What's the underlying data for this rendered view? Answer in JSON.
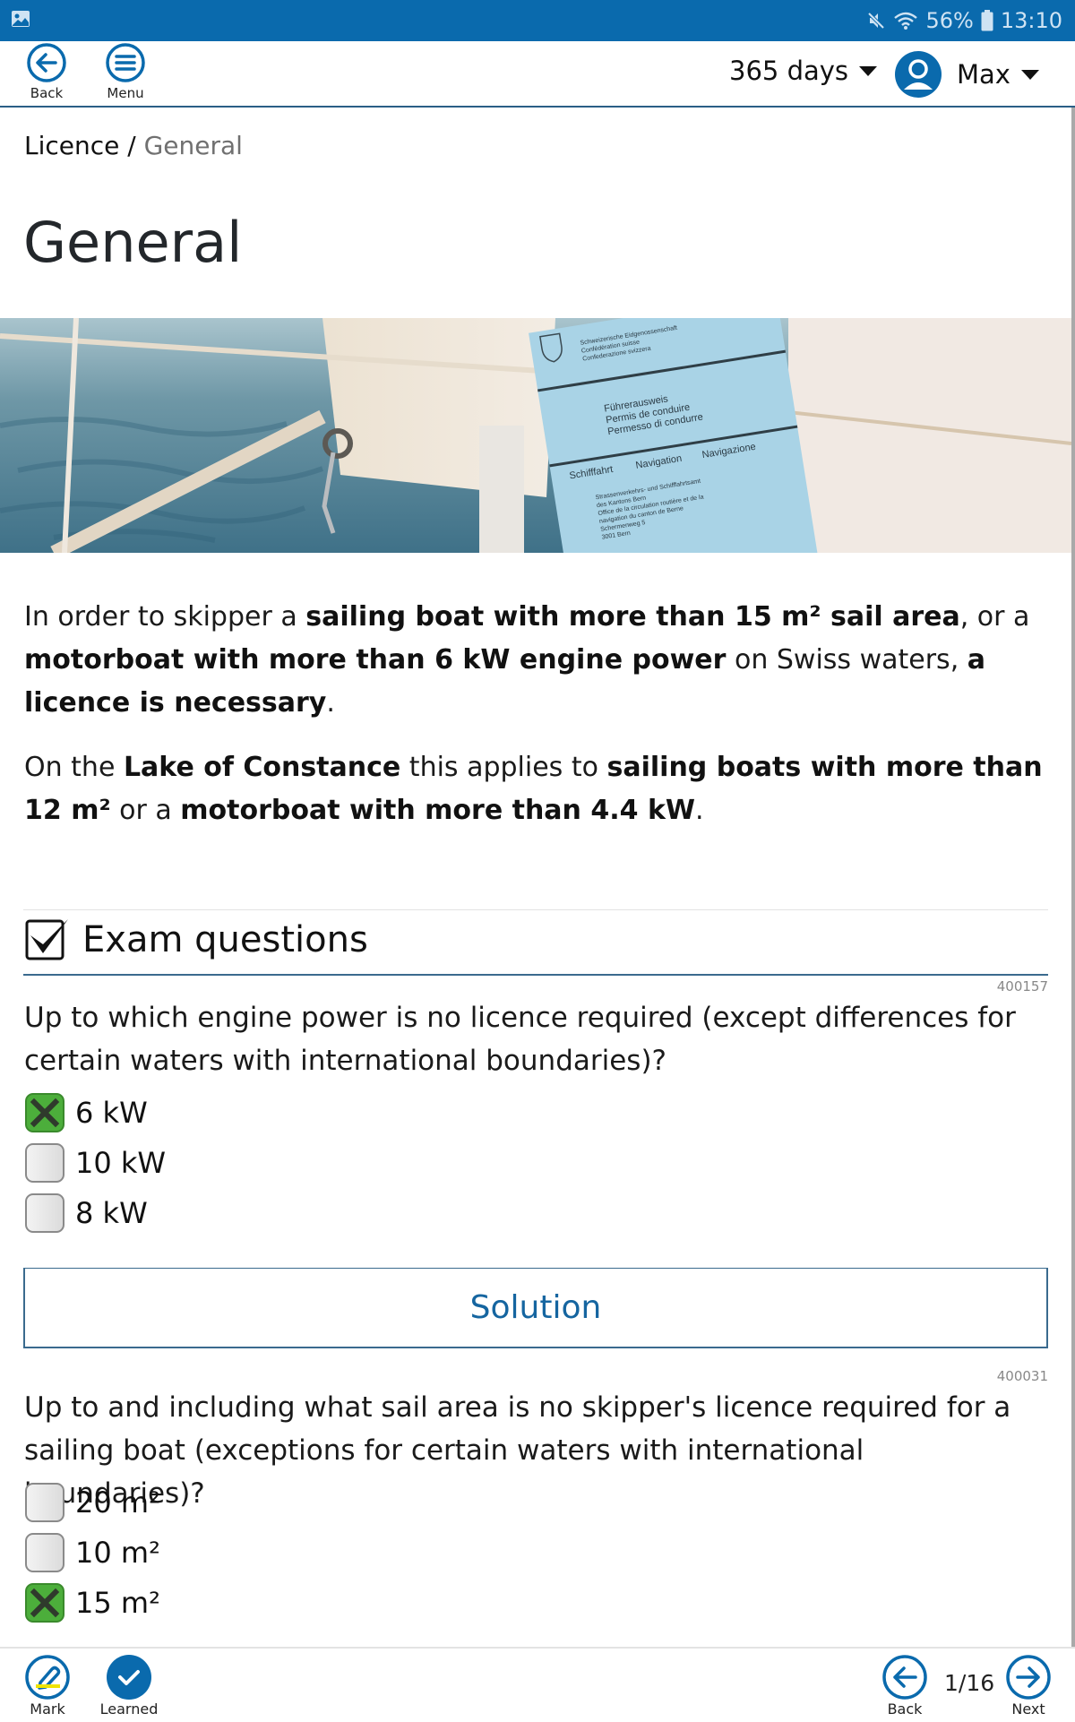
{
  "status_bar": {
    "battery": "56%",
    "time": "13:10",
    "icons": [
      "gallery-icon",
      "mute-icon",
      "wifi-icon",
      "battery-icon"
    ]
  },
  "header": {
    "back_label": "Back",
    "menu_label": "Menu",
    "period_select": "365 days",
    "user_name": "Max"
  },
  "breadcrumb": {
    "parent": "Licence",
    "separator": " / ",
    "current": "General"
  },
  "page_title": "General",
  "hero_image": {
    "alt": "Sail on water with Swiss boat licence",
    "licence_card": {
      "issuer_lines": [
        "Schweizerische Eidgenossenschaft",
        "Confédération suisse",
        "Confederazione svizzera"
      ],
      "title_lines": [
        "Führerausweis",
        "Permis de conduire",
        "Permesso di condurre"
      ],
      "categories": [
        "Schifffahrt",
        "Navigation",
        "Navigazione"
      ],
      "office_lines": [
        "Strassenverkehrs- und Schifffahrtsamt",
        "des Kantons Bern",
        "Office de la circulation routière et de la",
        "navigation du canton de Berne",
        "Schermenweg 5",
        "3001 Bern"
      ]
    }
  },
  "intro": {
    "p1": [
      {
        "t": "In order to skipper a ",
        "b": false
      },
      {
        "t": "sailing boat with more than 15 m² sail area",
        "b": true
      },
      {
        "t": ", or a ",
        "b": false
      },
      {
        "t": "motorboat with more than 6 kW engine power",
        "b": true
      },
      {
        "t": " on Swiss waters, ",
        "b": false
      },
      {
        "t": "a licence is necessary",
        "b": true
      },
      {
        "t": ".",
        "b": false
      }
    ],
    "p2": [
      {
        "t": "On the ",
        "b": false
      },
      {
        "t": "Lake of Constance",
        "b": true
      },
      {
        "t": " this applies to ",
        "b": false
      },
      {
        "t": "sailing boats with more than 12 m²",
        "b": true
      },
      {
        "t": " or a ",
        "b": false
      },
      {
        "t": "motorboat with more than 4.4 kW",
        "b": true
      },
      {
        "t": ".",
        "b": false
      }
    ]
  },
  "exam": {
    "heading": "Exam questions",
    "solution_label": "Solution",
    "questions": [
      {
        "id": "400157",
        "text": "Up to which engine power is no licence required (except differences for certain waters with international boundaries)?",
        "answers": [
          {
            "label": "6 kW",
            "checked": true
          },
          {
            "label": "10 kW",
            "checked": false
          },
          {
            "label": "8 kW",
            "checked": false
          }
        ]
      },
      {
        "id": "400031",
        "text": "Up to and including what sail area is no skipper's licence required for a sailing boat (exceptions for certain waters with international boundaries)?",
        "answers": [
          {
            "label": "20 m²",
            "checked": false
          },
          {
            "label": "10 m²",
            "checked": false
          },
          {
            "label": "15 m²",
            "checked": true
          }
        ]
      }
    ]
  },
  "bottom_bar": {
    "mark_label": "Mark",
    "learned_label": "Learned",
    "back_label": "Back",
    "next_label": "Next",
    "page_indicator": "1/16"
  },
  "colors": {
    "brand_blue": "#0a6aad",
    "check_green": "#4cae3b",
    "highlight_yellow": "#f0e400"
  }
}
